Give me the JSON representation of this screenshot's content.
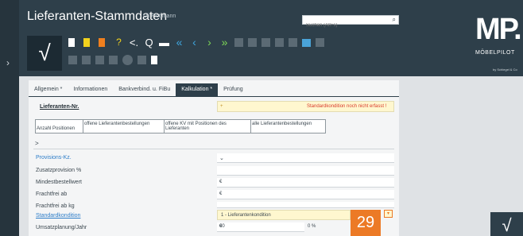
{
  "header": {
    "title": "Lieferanten-Stammdaten",
    "user": "Uli Flottmann",
    "search_placeholder": "Suchen (Alt+s)",
    "logo": "MP.",
    "logo_sub": "MÖBELPILOT",
    "logo_tiny": "by Schlegel & Co"
  },
  "toolbar": {
    "confirm": "√",
    "row1": [
      "new-doc-icon",
      "copy-doc-icon",
      "delete-icon",
      "help-icon",
      "back-icon",
      "search-icon",
      "print-icon",
      "first-icon",
      "prev-icon",
      "next-icon",
      "last-icon",
      "dim1-icon",
      "dim2-icon",
      "dim3-icon",
      "dim4-icon",
      "dim5-icon",
      "chart-icon",
      "dim6-icon"
    ],
    "row2": [
      "dim7-icon",
      "dim8-icon",
      "dim9-icon",
      "dim10-icon",
      "dim11-icon",
      "dim12-icon",
      "dim13-icon",
      "doc-icon"
    ]
  },
  "tabs": [
    {
      "label": "Allgemein *",
      "active": false
    },
    {
      "label": "Informationen",
      "active": false
    },
    {
      "label": "Bankverbind. u. FiBu",
      "active": false
    },
    {
      "label": "Kalkulation *",
      "active": true
    },
    {
      "label": "Prüfung",
      "active": false
    }
  ],
  "form": {
    "lieferanten_nr_label": "Lieferanten-Nr.",
    "lieferanten_nr_value": "+",
    "warning": "Standardkondition noch nicht erfasst !",
    "summary_headers": [
      "Anzahl Positionen",
      "offene Lieferantenbestellungen",
      "offene KV mit Positionen des Lieferanten",
      "alle Lieferantenbestellungen"
    ],
    "expander": ">",
    "fields": [
      {
        "label": "Provisions-Kz.",
        "link": true,
        "value": "",
        "dropdown": true
      },
      {
        "label": "Zusatzprovision %",
        "link": false,
        "value": "",
        "dropdown": false
      },
      {
        "label": "Mindestbestellwert",
        "link": false,
        "value": "€",
        "dropdown": false
      },
      {
        "label": "Frachtfrei ab",
        "link": false,
        "value": "€",
        "dropdown": false
      },
      {
        "label": "Frachtfrei ab kg",
        "link": false,
        "value": "",
        "dropdown": false
      }
    ],
    "standardkondition_label": "Standardkondition",
    "standardkondition_value": "1 - Lieferantenkondition",
    "umsatz_label": "Umsatzplanung/Jahr",
    "umsatz_currency": "€",
    "umsatz_value": "00",
    "umsatz_pct": "0 %"
  },
  "step_badge": "29",
  "dropdown_arrow": "▾",
  "confirm_bottom": "√"
}
